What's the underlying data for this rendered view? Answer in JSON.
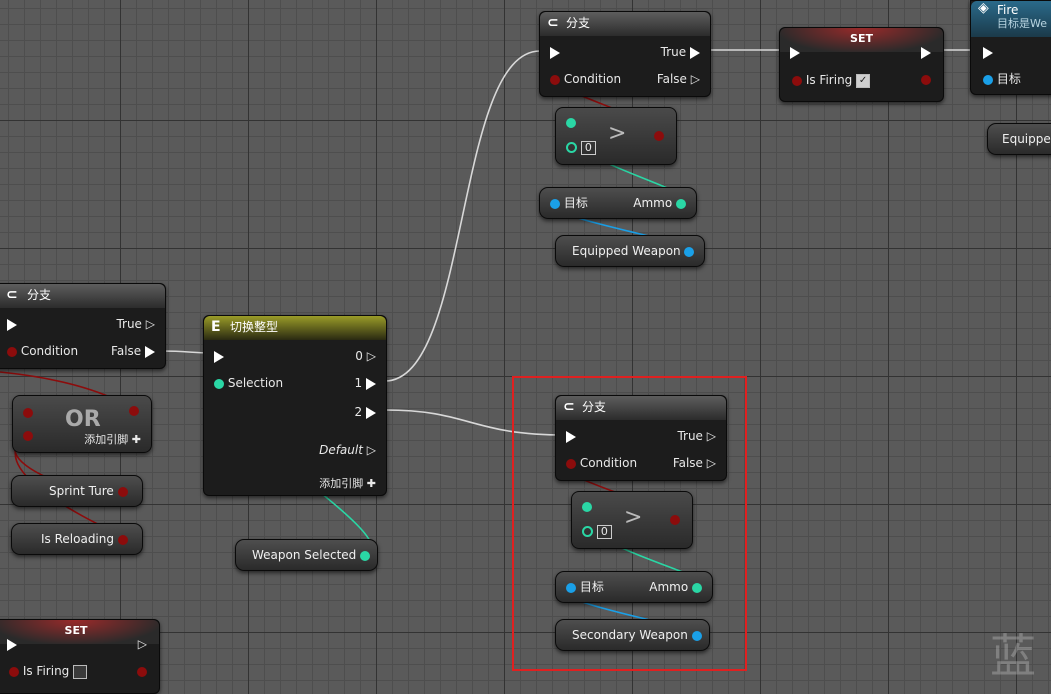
{
  "nodes": {
    "branch_top": {
      "title": "分支",
      "true_label": "True",
      "false_label": "False",
      "condition_label": "Condition"
    },
    "branch_left": {
      "title": "分支",
      "true_label": "True",
      "false_label": "False",
      "condition_label": "Condition"
    },
    "branch_sel": {
      "title": "分支",
      "true_label": "True",
      "false_label": "False",
      "condition_label": "Condition"
    },
    "switch": {
      "title": "切换整型",
      "selection_label": "Selection",
      "out0": "0",
      "out1": "1",
      "out2": "2",
      "default_label": "Default",
      "add_pin_label": "添加引脚"
    },
    "set_top": {
      "title": "SET",
      "var_label": "Is Firing",
      "checked": true
    },
    "set_bottom": {
      "title": "SET",
      "var_label": "Is Firing",
      "checked": false
    },
    "fire": {
      "title": "Fire",
      "subtitle": "目标是We",
      "target_label": "目标"
    },
    "or_node": {
      "title": "OR",
      "add_pin_label": "添加引脚"
    },
    "compare_top": {
      "op": ">",
      "value": "0"
    },
    "compare_sel": {
      "op": ">",
      "value": "0"
    },
    "ammo_top": {
      "target_label": "目标",
      "out_label": "Ammo"
    },
    "ammo_sel": {
      "target_label": "目标",
      "out_label": "Ammo"
    },
    "equipped_weapon": {
      "label": "Equipped Weapon"
    },
    "equipped_right": {
      "label": "Equippe"
    },
    "secondary_weapon": {
      "label": "Secondary Weapon"
    },
    "weapon_selected": {
      "label": "Weapon Selected"
    },
    "sprint_ture": {
      "label": "Sprint Ture"
    },
    "is_reloading": {
      "label": "Is Reloading"
    }
  },
  "watermark": "蓝",
  "colors": {
    "exec_wire": "#d8d8d8",
    "bool_wire": "#8c0c0c",
    "int_wire": "#2ad7a5",
    "object_wire": "#1aa0e8",
    "selection": "#e02020"
  }
}
